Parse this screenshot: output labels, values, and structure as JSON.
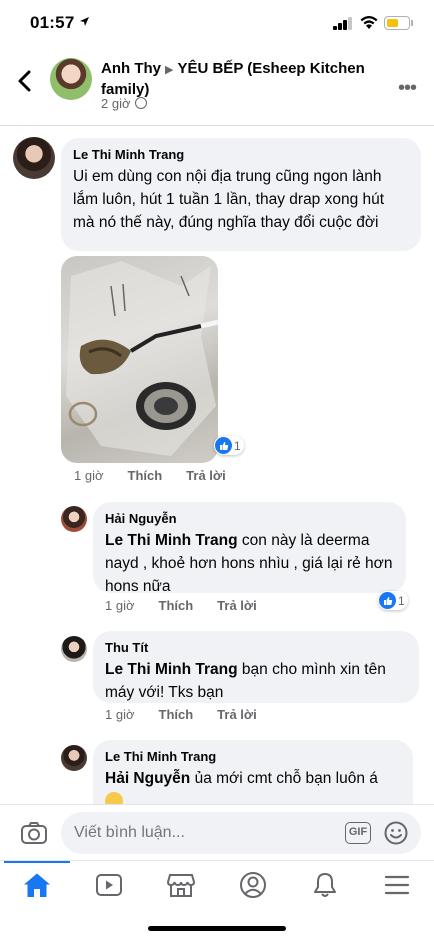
{
  "status_bar": {
    "time": "01:57"
  },
  "post_header": {
    "author": "Anh Thy",
    "group": "YÊU BẾP (Esheep Kitchen family)",
    "time": "2 giờ",
    "icons": {
      "back": "back-arrow-icon",
      "privacy": "globe-icon",
      "more": "more-icon"
    }
  },
  "comments": [
    {
      "name": "Le Thi Minh Trang",
      "text": "Ui em dùng con nội địa trung cũng ngon lành lắm luôn, hút 1 tuần 1 lần, thay drap xong hút mà nó thế này, đúng nghĩa thay đổi cuộc đời",
      "time": "1 giờ",
      "like": "Thích",
      "reply": "Trả lời",
      "reactions": "1"
    },
    {
      "name": "Hải Nguyễn",
      "mention": "Le Thi Minh Trang",
      "text": " con này là deerma nayd , khoẻ hơn hons nhìu , giá lại rẻ hơn hons nữa",
      "time": "1 giờ",
      "like": "Thích",
      "reply": "Trả lời",
      "reactions": "1"
    },
    {
      "name": "Thu Tít",
      "mention": "Le Thi Minh Trang",
      "text": " bạn cho mình xin tên máy với! Tks bạn",
      "time": "1 giờ",
      "like": "Thích",
      "reply": "Trả lời"
    },
    {
      "name": "Le Thi Minh Trang",
      "mention": "Hải Nguyễn",
      "text": " ủa mới cmt chỗ bạn luôn á"
    }
  ],
  "composer": {
    "placeholder": "Viết bình luận...",
    "gif_label": "GIF"
  },
  "tabbar": {
    "tabs": [
      "home-icon",
      "watch-icon",
      "marketplace-icon",
      "profile-icon",
      "notifications-icon",
      "menu-icon"
    ],
    "active": "home-icon",
    "active_color": "#1877f2"
  },
  "colors": {
    "accent": "#1877f2",
    "bubble": "#f0f2f5",
    "secondary_text": "#65676b"
  }
}
